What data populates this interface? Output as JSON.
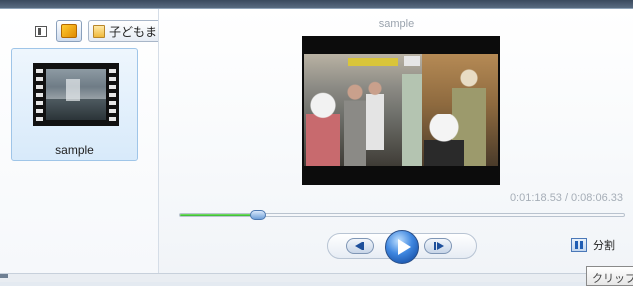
{
  "left_panel": {
    "folder_button": {
      "label": "子どもま",
      "icon": "folder-icon"
    },
    "view_button": {
      "icon": "view-toggle-icon"
    },
    "photo_button": {
      "icon": "photo-icon"
    },
    "clips": [
      {
        "name": "sample",
        "icon": "film-strip-icon"
      }
    ]
  },
  "preview": {
    "title": "sample",
    "current_time": "0:01:18.53",
    "total_time": "0:08:06.33",
    "time_separator": "/",
    "progress_fraction": 0.175,
    "progress_color": "#2fb52a"
  },
  "transport": {
    "prev_icon": "previous-frame-icon",
    "play_icon": "play-icon",
    "next_icon": "next-frame-icon"
  },
  "split": {
    "label": "分割",
    "icon": "split-icon"
  },
  "tooltip": {
    "text": "クリップ"
  }
}
